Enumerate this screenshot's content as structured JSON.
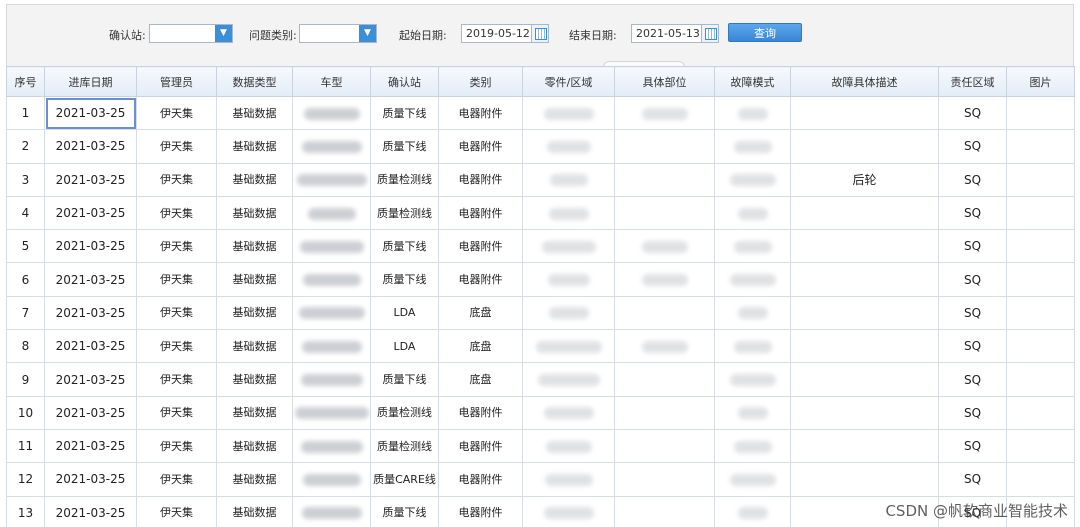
{
  "filter": {
    "confirm_station_label": "确认站:",
    "problem_type_label": "问题类别:",
    "start_date_label": "起始日期:",
    "start_date_value": "2019-05-12",
    "end_date_label": "结束日期:",
    "end_date_value": "2021-05-13",
    "query_button": "查询"
  },
  "table": {
    "headers": [
      "序号",
      "进库日期",
      "管理员",
      "数据类型",
      "车型",
      "确认站",
      "类别",
      "零件/区域",
      "具体部位",
      "故障模式",
      "故障具体描述",
      "责任区域",
      "图片"
    ],
    "rows": [
      {
        "no": "1",
        "date": "2021-03-25",
        "admin": "伊天集",
        "dtype": "基础数据",
        "station": "质量下线",
        "category": "电器附件",
        "desc": "",
        "area": "SQ"
      },
      {
        "no": "2",
        "date": "2021-03-25",
        "admin": "伊天集",
        "dtype": "基础数据",
        "station": "质量下线",
        "category": "电器附件",
        "desc": "",
        "area": "SQ"
      },
      {
        "no": "3",
        "date": "2021-03-25",
        "admin": "伊天集",
        "dtype": "基础数据",
        "station": "质量检测线",
        "category": "电器附件",
        "desc": "后轮",
        "area": "SQ"
      },
      {
        "no": "4",
        "date": "2021-03-25",
        "admin": "伊天集",
        "dtype": "基础数据",
        "station": "质量检测线",
        "category": "电器附件",
        "desc": "",
        "area": "SQ"
      },
      {
        "no": "5",
        "date": "2021-03-25",
        "admin": "伊天集",
        "dtype": "基础数据",
        "station": "质量下线",
        "category": "电器附件",
        "desc": "",
        "area": "SQ"
      },
      {
        "no": "6",
        "date": "2021-03-25",
        "admin": "伊天集",
        "dtype": "基础数据",
        "station": "质量下线",
        "category": "电器附件",
        "desc": "",
        "area": "SQ"
      },
      {
        "no": "7",
        "date": "2021-03-25",
        "admin": "伊天集",
        "dtype": "基础数据",
        "station": "LDA",
        "category": "底盘",
        "desc": "",
        "area": "SQ"
      },
      {
        "no": "8",
        "date": "2021-03-25",
        "admin": "伊天集",
        "dtype": "基础数据",
        "station": "LDA",
        "category": "底盘",
        "desc": "",
        "area": "SQ"
      },
      {
        "no": "9",
        "date": "2021-03-25",
        "admin": "伊天集",
        "dtype": "基础数据",
        "station": "质量下线",
        "category": "底盘",
        "desc": "",
        "area": "SQ"
      },
      {
        "no": "10",
        "date": "2021-03-25",
        "admin": "伊天集",
        "dtype": "基础数据",
        "station": "质量检测线",
        "category": "电器附件",
        "desc": "",
        "area": "SQ"
      },
      {
        "no": "11",
        "date": "2021-03-25",
        "admin": "伊天集",
        "dtype": "基础数据",
        "station": "质量检测线",
        "category": "电器附件",
        "desc": "",
        "area": "SQ"
      },
      {
        "no": "12",
        "date": "2021-03-25",
        "admin": "伊天集",
        "dtype": "基础数据",
        "station": "质量CARE线",
        "category": "电器附件",
        "desc": "",
        "area": "SQ"
      },
      {
        "no": "13",
        "date": "2021-03-25",
        "admin": "伊天集",
        "dtype": "基础数据",
        "station": "质量下线",
        "category": "电器附件",
        "desc": "",
        "area": "SQ"
      }
    ]
  },
  "watermark": "CSDN @帆软商业智能技术"
}
